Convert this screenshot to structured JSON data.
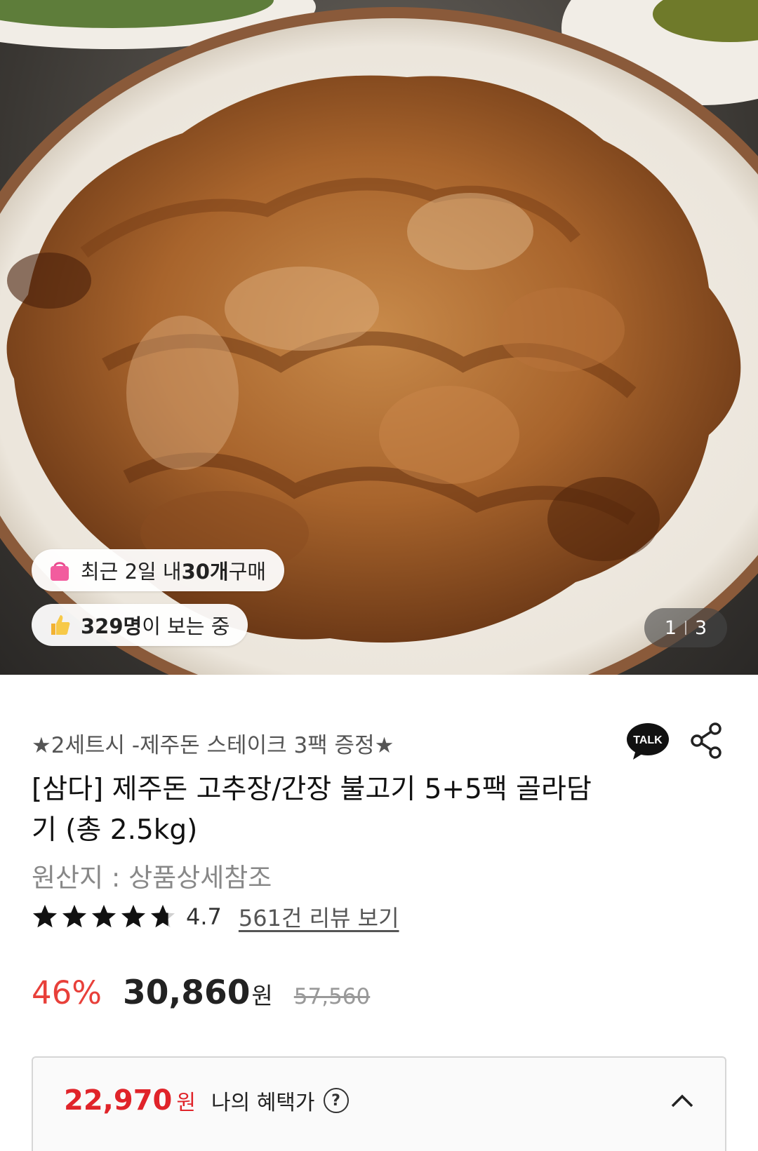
{
  "hero": {
    "recent_purchase": {
      "prefix": "최근 2일 내 ",
      "count": "30개",
      "suffix": " 구매",
      "icon": "shopping-bag-icon"
    },
    "viewers": {
      "count": "329명",
      "suffix": "이 보는 중",
      "icon": "thumbs-up-icon"
    },
    "image_counter": {
      "current": "1",
      "total": "3"
    }
  },
  "product": {
    "promo": "★2세트시 -제주돈 스테이크 3팩 증정★",
    "title": "[삼다] 제주돈 고추장/간장 불고기 5+5팩 골라담기 (총 2.5kg)",
    "origin": "원산지 : 상품상세참조",
    "rating_value": 4.7,
    "rating_text": "4.7",
    "review_link": "561건 리뷰 보기",
    "talk_icon_label": "TALK",
    "share_icon": "share-icon"
  },
  "price": {
    "discount": "46%",
    "sale_price": "30,860",
    "currency": "원",
    "original_price": "57,560",
    "discount_color": "#e8403a"
  },
  "benefit": {
    "price": "22,970",
    "currency": "원",
    "label": "나의 혜택가",
    "help_glyph": "?",
    "price_color": "#e0242a"
  }
}
